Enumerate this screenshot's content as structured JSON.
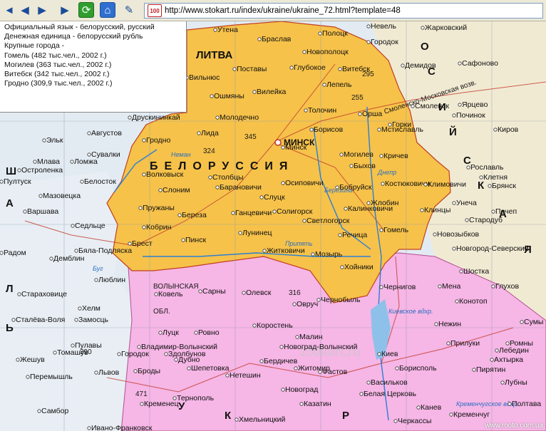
{
  "browser": {
    "url": "http://www.stokart.ru/index/ukraine/ukraine_72.html?template=48",
    "favicon_text": "100"
  },
  "info": {
    "lines": [
      "Официальный язык - белорусский, русский",
      "Денежная единица - белорусский рубль",
      "Крупные города -",
      "Гомель (482 тыс.чел., 2002 г.)",
      "Могилев (363 тыс.чел., 2002 г.)",
      "Витебск (342 тыс.чел., 2002 г.)",
      "Гродно (309,9 тыс.чел., 2002 г.)"
    ]
  },
  "map": {
    "country_label": "БЕЛОРУССИЯ",
    "neighbors": {
      "lithuania": "ЛИТВА"
    },
    "side_letters": {
      "poland": [
        "Ш",
        "А",
        "Л",
        "Ь"
      ],
      "russia": [
        "О",
        "С",
        "И",
        "Й",
        "С",
        "К",
        "А",
        "Я"
      ],
      "ukraine": [
        "У",
        "К",
        "Р"
      ]
    },
    "capital": "МИНСК",
    "roads": {
      "moscow": "Смоленско-Московская возв."
    },
    "water": [
      "Днепр",
      "Припять",
      "Березина",
      "Неман",
      "Буг",
      "Киевское вдхр.",
      "Кременчугское вдхр."
    ],
    "regions": [
      "ВОЛЫНСКАЯ",
      "ОБЛ."
    ],
    "numbers": [
      "295",
      "255",
      "345",
      "324",
      "316",
      "390",
      "471"
    ],
    "watermark": "100kart.ru",
    "cities": [
      "Утена",
      "Браслав",
      "Полоцк",
      "Новополоцк",
      "Городок",
      "Глубокое",
      "Витебск",
      "Невель",
      "Демидов",
      "Сафоново",
      "Поставы",
      "Лепель",
      "Вильнюс",
      "Ошмяны",
      "Вилейка",
      "Орша",
      "Смоленск",
      "Ярцево",
      "Молодечно",
      "Толочин",
      "Друскининкай",
      "Гродно",
      "Лида",
      "Борисов",
      "Мстиславль",
      "Горки",
      "Починок",
      "Киров",
      "Рославль",
      "Августов",
      "Эльк",
      "Сувалки",
      "Жарковский",
      "Столбцы",
      "Минск",
      "Могилев",
      "Кричев",
      "Быхов",
      "Волковыск",
      "Слоним",
      "Барановичи",
      "Осиповичи",
      "Бобруйск",
      "Костюковичи",
      "Климовичи",
      "Клетня",
      "Брянск",
      "Остроленка",
      "Ломжа",
      "Млава",
      "Белосток",
      "Пултуск",
      "Мазовецка",
      "Варшава",
      "Седльце",
      "Пружаны",
      "Береза",
      "Ганцевичи",
      "Солигорск",
      "Слуцк",
      "Жлобин",
      "Светлогорск",
      "Клинцы",
      "Унеча",
      "Почеп",
      "Брест",
      "Кобрин",
      "Пинск",
      "Лунинец",
      "Калинковичи",
      "Речица",
      "Гомель",
      "Стародуб",
      "Новозыбков",
      "Бяла-Подляска",
      "Демблин",
      "Мозырь",
      "Житковичи",
      "Хойники",
      "Новгород-Северский",
      "Радом",
      "Люблин",
      "Хелм",
      "Ковель",
      "Сарны",
      "Олевск",
      "Чернобыль",
      "Овруч",
      "Чернигов",
      "Шостка",
      "Мена",
      "Глухов",
      "Конотоп",
      "Нежин",
      "Прилуки",
      "Ромны",
      "Сумы",
      "Ахтырка",
      "Лебедин",
      "Луцк",
      "Ровно",
      "Коростень",
      "Малин",
      "Новоград-Волынский",
      "Житомир",
      "Киев",
      "Борисполь",
      "Пирятин",
      "Лубны",
      "Полтава",
      "Замосць",
      "Томашув",
      "Владимир-Волынский",
      "Дубно",
      "Шепетовка",
      "Бердичев",
      "Фастов",
      "Васильков",
      "Белая Церковь",
      "Канев",
      "Черкассы",
      "Кременчуг",
      "Львов",
      "Броды",
      "Тернополь",
      "Хмельницкий",
      "Казатин",
      "Жешув",
      "Перемышль",
      "Самбор",
      "Сталёва-Воля",
      "Стараховице",
      "Пулавы",
      "Нетешин",
      "Здолбунов",
      "Кременец",
      "Ивано-Франковск",
      "Городок",
      "Новоград"
    ],
    "footer": "www.moto.com.ua"
  },
  "colors": {
    "belarus": "#f6c24a",
    "ukraine": "#f5b3e4",
    "background": "#dfe8f0",
    "russia": "#f2ecd8",
    "poland": "#e7eef5"
  }
}
